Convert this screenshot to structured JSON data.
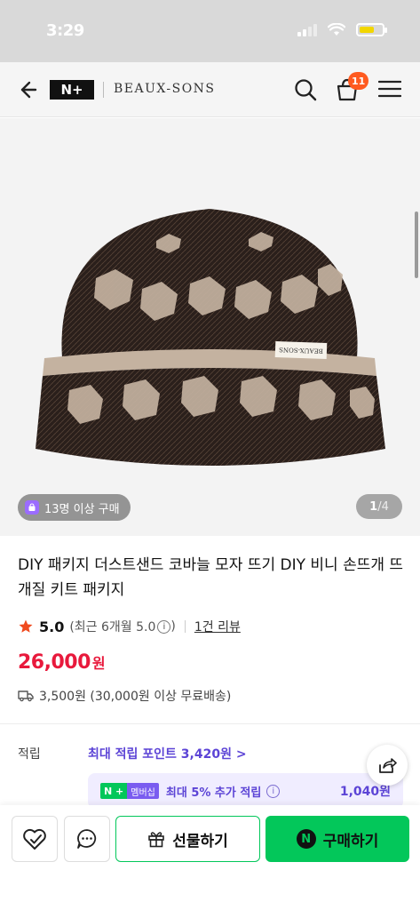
{
  "status_bar": {
    "time": "3:29"
  },
  "header": {
    "logo_text": "N+",
    "brand": "BEAUX-SONS",
    "cart_count": "11"
  },
  "product_image": {
    "label_on_hat": "BEAUX-SONS",
    "group_buy_chip": "13명 이상 구매",
    "pager_current": "1",
    "pager_total": "/4",
    "hat_colors": {
      "base": "#2a1f1b",
      "pattern": "#c4b2a0"
    }
  },
  "product": {
    "title": "DIY 패키지 더스트샌드 코바늘 모자 뜨기 DIY 비니 손뜨개 뜨개질 키트 패키지",
    "rating_score": "5.0",
    "rating_detail": "(최근 6개월 5.0",
    "rating_info_icon": "i",
    "rating_close": ")",
    "review_link": "1건 리뷰",
    "price": "26,000",
    "price_unit": "원",
    "shipping": "3,500원 (30,000원 이상 무료배송)"
  },
  "points": {
    "label": "적립",
    "max_points": "최대 적립 포인트 3,420원 >",
    "membership_logo": "N +",
    "membership_tag": "멤버십",
    "membership_rate": "최대 5% 추가 적립",
    "membership_amount": "1,040원"
  },
  "bottom_bar": {
    "gift_label": "선물하기",
    "buy_label": "구매하기",
    "buy_icon_letter": "N"
  },
  "colors": {
    "price_red": "#e8193c",
    "naver_green": "#03c75a",
    "points_purple": "#5c44d6",
    "cart_badge": "#ff5a1f"
  }
}
